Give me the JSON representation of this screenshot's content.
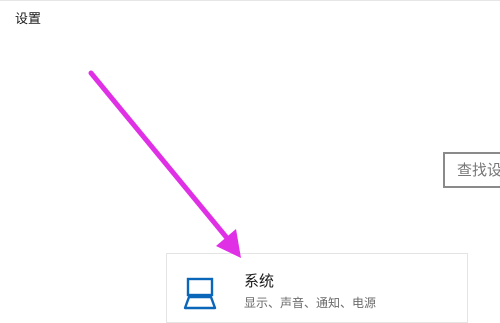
{
  "window": {
    "title": "设置"
  },
  "search": {
    "text": "查找设"
  },
  "tiles": [
    {
      "title": "系统",
      "description": "显示、声音、通知、电源",
      "icon": "laptop-icon"
    }
  ],
  "colors": {
    "annotation_arrow": "#e030e6",
    "icon_stroke": "#0a66b8",
    "search_border": "#8a8a8a"
  }
}
